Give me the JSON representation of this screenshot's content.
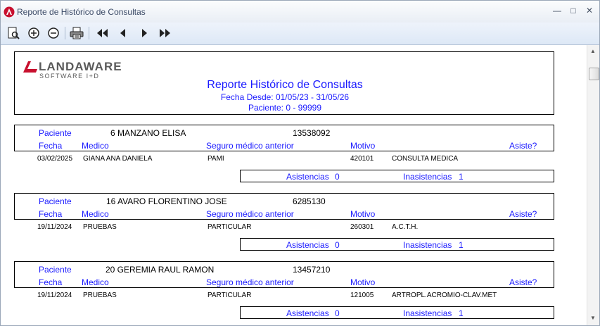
{
  "window": {
    "title": "Reporte de Histórico de Consultas",
    "min": "—",
    "max": "□",
    "close": "✕"
  },
  "toolbar": {
    "icons": [
      "preview-icon",
      "zoom-in-icon",
      "zoom-out-icon",
      "print-icon",
      "first-page-icon",
      "prev-page-icon",
      "next-page-icon",
      "last-page-icon"
    ]
  },
  "header": {
    "logo_brand": "LANDAWARE",
    "logo_tagline": "SOFTWARE I+D",
    "title": "Reporte Histórico de Consultas",
    "date_range": "Fecha Desde: 01/05/23 - 31/05/26",
    "patient_range": "Paciente: 0 - 99999"
  },
  "labels": {
    "paciente": "Paciente",
    "fecha": "Fecha",
    "medico": "Medico",
    "seguro": "Seguro médico anterior",
    "motivo": "Motivo",
    "asiste": "Asiste?",
    "asistencias": "Asistencias",
    "inasistencias": "Inasistencias"
  },
  "records": [
    {
      "patient_name": "6 MANZANO ELISA",
      "patient_number": "13538092",
      "row": {
        "fecha": "03/02/2025",
        "medico": "GIANA ANA DANIELA",
        "seguro": "PAMI",
        "motivo_code": "420101",
        "motivo_desc": "CONSULTA MEDICA"
      },
      "asistencias": "0",
      "inasistencias": "1"
    },
    {
      "patient_name": "16 AVARO FLORENTINO JOSE",
      "patient_number": "6285130",
      "row": {
        "fecha": "19/11/2024",
        "medico": "PRUEBAS",
        "seguro": "PARTICULAR",
        "motivo_code": "260301",
        "motivo_desc": "A.C.T.H."
      },
      "asistencias": "0",
      "inasistencias": "1"
    },
    {
      "patient_name": "20 GEREMIA RAUL RAMON",
      "patient_number": "13457210",
      "row": {
        "fecha": "19/11/2024",
        "medico": "PRUEBAS",
        "seguro": "PARTICULAR",
        "motivo_code": "121005",
        "motivo_desc": "ARTROPL.ACROMIO-CLAV.MET"
      },
      "asistencias": "0",
      "inasistencias": "1"
    }
  ],
  "colors": {
    "report_text": "#1a1aff",
    "logo_red": "#c8102e",
    "logo_gray": "#5a5a5a"
  }
}
